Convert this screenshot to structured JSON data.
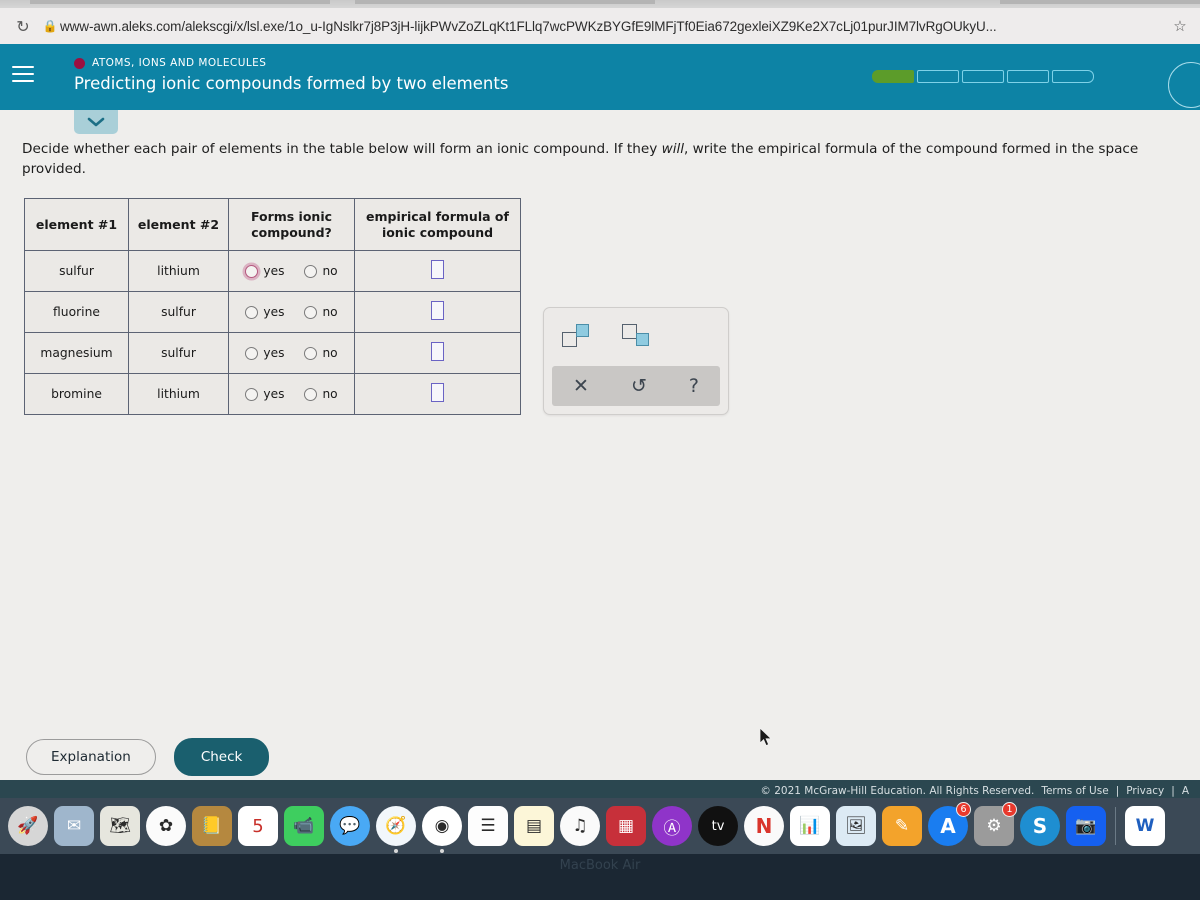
{
  "browser": {
    "reload_icon": "reload-icon",
    "lock_icon": "lock-icon",
    "url": "www-awn.aleks.com/alekscgi/x/lsl.exe/1o_u-IgNslkr7j8P3jH-lijkPWvZoZLqKt1FLlq7wcPWKzBYGfE9lMFjTf0Eia672gexleiXZ9Ke2X7cLj01purJIM7lvRgOUkyU...",
    "star_icon": "star-icon"
  },
  "header": {
    "menu_icon": "hamburger-menu-icon",
    "topic_dot_color": "#9b1040",
    "topic": "ATOMS, IONS AND MOLECULES",
    "title": "Predicting ionic compounds formed by two elements",
    "progress": {
      "total_segments": 5,
      "completed_segments": 1,
      "fill_color": "#5c9c2a",
      "outline_color": "#7fd2e8"
    },
    "background_color": "#0d83a5",
    "avatar_icon": "avatar-circle-icon"
  },
  "content": {
    "collapse_icon": "chevron-down-icon",
    "instruction_part1": "Decide whether each pair of elements in the table below will form an ionic compound. If they ",
    "instruction_italic": "will",
    "instruction_part2": ", write the empirical formula of the compound formed in the space provided."
  },
  "table": {
    "headers": [
      "element #1",
      "element #2",
      "Forms ionic compound?",
      "empirical formula of ionic compound"
    ],
    "yes_label": "yes",
    "no_label": "no",
    "rows": [
      {
        "element1": "sulfur",
        "element2": "lithium",
        "selected": "none",
        "highlight": "yes",
        "formula": ""
      },
      {
        "element1": "fluorine",
        "element2": "sulfur",
        "selected": "none",
        "highlight": "none",
        "formula": ""
      },
      {
        "element1": "magnesium",
        "element2": "sulfur",
        "selected": "none",
        "highlight": "none",
        "formula": ""
      },
      {
        "element1": "bromine",
        "element2": "lithium",
        "selected": "none",
        "highlight": "none",
        "formula": ""
      }
    ]
  },
  "chem_toolbar": {
    "superscript_icon": "superscript-icon",
    "subscript_icon": "subscript-icon",
    "clear_label": "✕",
    "undo_label": "↺",
    "help_label": "?"
  },
  "actions": {
    "explanation_label": "Explanation",
    "check_label": "Check",
    "check_color": "#1a5f6e"
  },
  "footer": {
    "copyright": "© 2021 McGraw-Hill Education. All Rights Reserved.",
    "links": [
      "Terms of Use",
      "Privacy",
      "A"
    ],
    "separator": "|"
  },
  "dock": {
    "items": [
      {
        "name": "launchpad",
        "glyph": "🚀",
        "bg": "#d6d6d6",
        "round": true,
        "running": false,
        "badge": ""
      },
      {
        "name": "mail-stamp",
        "glyph": "✉",
        "bg": "#9fb6cc",
        "round": false,
        "running": false,
        "badge": ""
      },
      {
        "name": "maps",
        "glyph": "🗺",
        "bg": "#e6e6de",
        "round": false,
        "running": false,
        "badge": ""
      },
      {
        "name": "photos",
        "glyph": "✿",
        "bg": "#fbfbfb",
        "round": true,
        "running": false,
        "badge": ""
      },
      {
        "name": "contacts",
        "glyph": "📒",
        "bg": "#b5883f",
        "round": false,
        "running": false,
        "badge": ""
      },
      {
        "name": "calendar",
        "glyph": "5",
        "bg": "#ffffff",
        "round": false,
        "running": false,
        "badge": ""
      },
      {
        "name": "facetime",
        "glyph": "📹",
        "bg": "#3ece5f",
        "round": false,
        "running": false,
        "badge": ""
      },
      {
        "name": "messages",
        "glyph": "💬",
        "bg": "#49a9f5",
        "round": true,
        "running": false,
        "badge": ""
      },
      {
        "name": "safari",
        "glyph": "🧭",
        "bg": "#f2f7fb",
        "round": true,
        "running": true,
        "badge": ""
      },
      {
        "name": "chrome",
        "glyph": "◉",
        "bg": "#ffffff",
        "round": true,
        "running": true,
        "badge": ""
      },
      {
        "name": "reminders",
        "glyph": "☰",
        "bg": "#fdfdfd",
        "round": false,
        "running": false,
        "badge": ""
      },
      {
        "name": "notes",
        "glyph": "▤",
        "bg": "#fcf6d8",
        "round": false,
        "running": false,
        "badge": ""
      },
      {
        "name": "music",
        "glyph": "♫",
        "bg": "#fafafa",
        "round": true,
        "running": false,
        "badge": ""
      },
      {
        "name": "photo-booth",
        "glyph": "▦",
        "bg": "#c7303a",
        "round": false,
        "running": false,
        "badge": ""
      },
      {
        "name": "podcasts",
        "glyph": "Ⓐ",
        "bg": "#8f34c9",
        "round": true,
        "running": false,
        "badge": ""
      },
      {
        "name": "apple-tv",
        "glyph": "tv",
        "bg": "#111111",
        "round": true,
        "running": false,
        "badge": ""
      },
      {
        "name": "news",
        "glyph": "N",
        "bg": "#fafafa",
        "round": true,
        "running": false,
        "badge": ""
      },
      {
        "name": "numbers",
        "glyph": "📊",
        "bg": "#ffffff",
        "round": false,
        "running": false,
        "badge": ""
      },
      {
        "name": "keynote",
        "glyph": "🖼",
        "bg": "#dceaf4",
        "round": false,
        "running": false,
        "badge": ""
      },
      {
        "name": "pages",
        "glyph": "✎",
        "bg": "#f3a32b",
        "round": false,
        "running": false,
        "badge": ""
      },
      {
        "name": "app-store",
        "glyph": "A",
        "bg": "#1a7df0",
        "round": true,
        "running": false,
        "badge": "6"
      },
      {
        "name": "system-preferences",
        "glyph": "⚙",
        "bg": "#9b9b9b",
        "round": false,
        "running": false,
        "badge": "1"
      },
      {
        "name": "skype",
        "glyph": "S",
        "bg": "#1e8ed1",
        "round": true,
        "running": false,
        "badge": ""
      },
      {
        "name": "zoom",
        "glyph": "📷",
        "bg": "#1560f0",
        "round": false,
        "running": false,
        "badge": ""
      },
      {
        "name": "microsoft-word",
        "glyph": "W",
        "bg": "#ffffff",
        "round": false,
        "running": false,
        "badge": ""
      }
    ]
  },
  "desktop": {
    "label": "MacBook Air"
  }
}
